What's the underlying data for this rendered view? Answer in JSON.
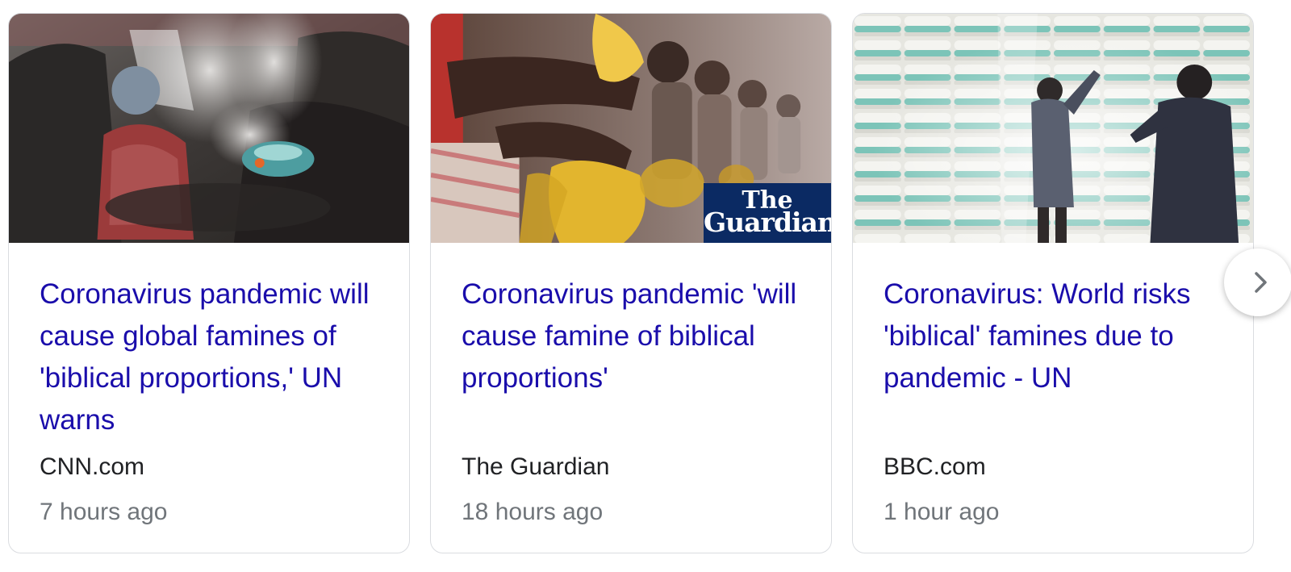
{
  "articles": [
    {
      "headline": "Coronavirus pandemic will cause global famines of 'biblical proportions,' UN warns",
      "source": "CNN.com",
      "time": "7 hours ago"
    },
    {
      "headline": "Coronavirus pandemic 'will cause famine of biblical proportions'",
      "source": "The Guardian",
      "time": "18 hours ago",
      "logo_line1": "The",
      "logo_line2": "Guardian"
    },
    {
      "headline": "Coronavirus: World risks 'biblical' famines due to pandemic - UN",
      "source": "BBC.com",
      "time": "1 hour ago"
    }
  ],
  "icons": {
    "next": "chevron-right-icon"
  },
  "colors": {
    "headline": "#1a0dab",
    "source": "#202124",
    "time": "#70757a",
    "card_border": "#dadce0",
    "guardian_blue": "#0b2a63"
  }
}
